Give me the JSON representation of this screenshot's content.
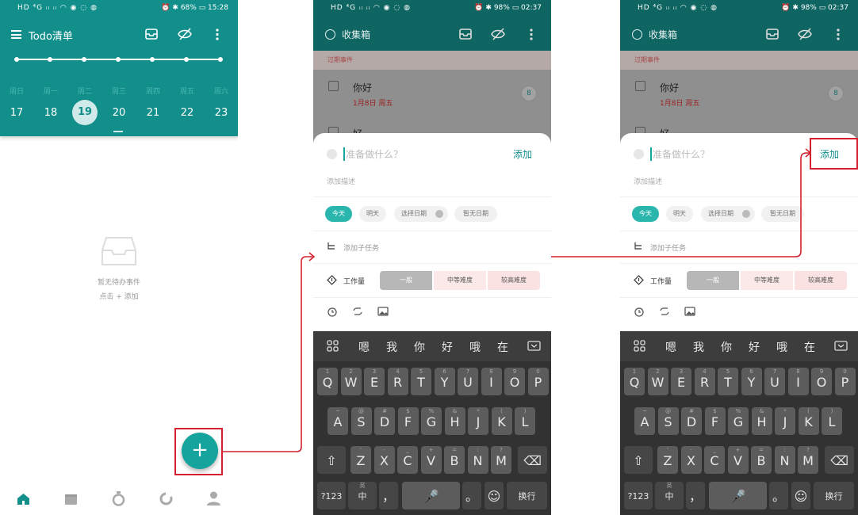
{
  "status": {
    "left_icons": "HD ⁴G ᵢₗ ᵢₗ ◠ ◉ ◌ ◍",
    "p1_right": "⏰ ✱ 68% ▭ 15:28",
    "p23_right": "⏰ ✱ 98% ▭ 02:37"
  },
  "screen1": {
    "title": "Todo清单",
    "weekdays": [
      "周日",
      "周一",
      "周二",
      "周三",
      "周四",
      "周五",
      "周六"
    ],
    "days": [
      "17",
      "18",
      "19",
      "20",
      "21",
      "22",
      "23"
    ],
    "selected_day": "19",
    "empty_line1": "暂无待办事件",
    "empty_line2": "点击 + 添加",
    "fab": "+",
    "nav": [
      "home-icon",
      "calendar-icon",
      "timer-icon",
      "habit-icon",
      "profile-icon"
    ]
  },
  "screen2": {
    "title": "收集箱",
    "overdue_label": "过期事件",
    "task_name": "你好",
    "task_date": "1月8日 周五",
    "task_badge": "8",
    "next_task_name": "好",
    "input_placeholder": "准备做什么？",
    "add_label": "添加",
    "desc_placeholder": "添加描述",
    "date_chips": [
      "今天",
      "明天",
      "选择日期",
      "暂无日期"
    ],
    "subtask_label": "添加子任务",
    "work_label": "工作量",
    "difficulty": [
      "一般",
      "中等难度",
      "较高难度"
    ],
    "tool_icons": [
      "alarm-icon",
      "repeat-icon",
      "image-icon"
    ]
  },
  "keyboard": {
    "candidates": [
      "嗯",
      "我",
      "你",
      "好",
      "哦",
      "在"
    ],
    "row1": [
      "Q",
      "W",
      "E",
      "R",
      "T",
      "Y",
      "U",
      "I",
      "O",
      "P"
    ],
    "row1_sub": [
      "1",
      "2",
      "3",
      "4",
      "5",
      "6",
      "7",
      "8",
      "9",
      "0"
    ],
    "row2": [
      "A",
      "S",
      "D",
      "F",
      "G",
      "H",
      "J",
      "K",
      "L"
    ],
    "row2_sub": [
      "~",
      "@",
      "#",
      "$",
      "%",
      "&",
      "*",
      "(",
      ")"
    ],
    "row3": [
      "Z",
      "X",
      "C",
      "V",
      "B",
      "N",
      "M"
    ],
    "row3_sub": [
      "'",
      "-",
      "_",
      "+",
      "=",
      ":",
      "?"
    ],
    "k123": "?123",
    "kzh": "中",
    "kzh_sub": "英",
    "kcomma": "，",
    "kperiod": "。",
    "kenter": "换行"
  },
  "colors": {
    "teal": "#128f8b",
    "callout": "#d42030"
  }
}
